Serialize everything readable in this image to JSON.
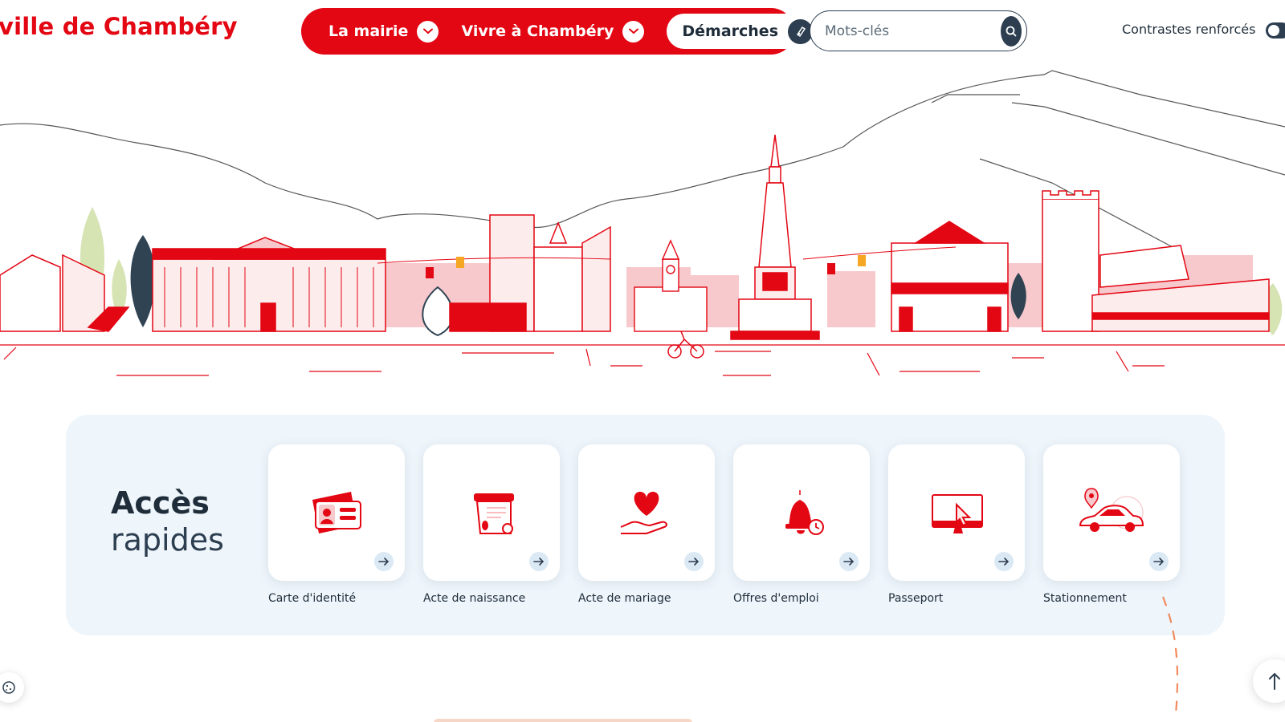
{
  "header": {
    "logo": "ville de Chambéry",
    "nav": [
      {
        "label": "La mairie",
        "icon": "chevron-down-icon"
      },
      {
        "label": "Vivre à Chambéry",
        "icon": "chevron-down-icon"
      }
    ],
    "demarches": {
      "label": "Démarches",
      "icon": "pen-icon"
    },
    "search": {
      "placeholder": "Mots-clés",
      "icon": "search-icon"
    },
    "contrast": {
      "label": "Contrastes renforcés"
    }
  },
  "hero": {
    "illustration": "chambery-skyline-illustration"
  },
  "quick_access": {
    "title_line1": "Accès",
    "title_line2": "rapides",
    "items": [
      {
        "label": "Carte d'identité",
        "icon": "id-card-icon"
      },
      {
        "label": "Acte de naissance",
        "icon": "birth-certificate-icon"
      },
      {
        "label": "Acte de mariage",
        "icon": "heart-hand-icon"
      },
      {
        "label": "Offres d'emploi",
        "icon": "bell-clock-icon"
      },
      {
        "label": "Passeport",
        "icon": "monitor-cursor-icon"
      },
      {
        "label": "Stationnement",
        "icon": "car-pin-icon"
      }
    ]
  },
  "colors": {
    "brand_red": "#e30613",
    "dark": "#2c3e50",
    "panel": "#eef5fb",
    "peach": "#f6d6c6"
  }
}
